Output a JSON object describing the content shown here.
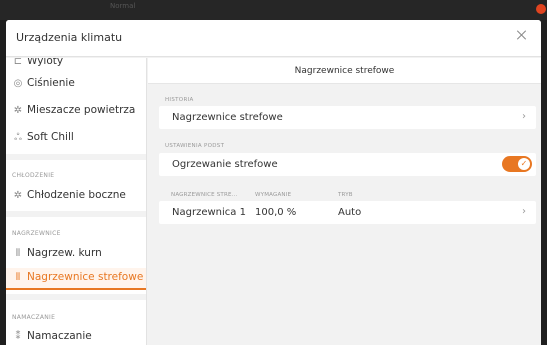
{
  "window": {
    "title": "Urządzenia klimatu",
    "background_label": "Normal"
  },
  "sidebar": {
    "items_top": [
      {
        "label": "Wyloty",
        "icon": "vent-icon"
      },
      {
        "label": "Ciśnienie",
        "icon": "pressure-icon"
      },
      {
        "label": "Mieszacze powietrza",
        "icon": "fan-icon"
      },
      {
        "label": "Soft Chill",
        "icon": "soft-chill-icon"
      }
    ],
    "section_cooling": {
      "title": "CHŁODZENIE",
      "items": [
        {
          "label": "Chłodzenie boczne",
          "icon": "fan-icon"
        }
      ]
    },
    "section_heaters": {
      "title": "NAGRZEWNICE",
      "items": [
        {
          "label": "Nagrzew. kurn",
          "icon": "heater-icon"
        },
        {
          "label": "Nagrzewnice strefowe",
          "icon": "heater-icon",
          "active": true
        }
      ]
    },
    "section_humid": {
      "title": "NAMACZANIE",
      "items": [
        {
          "label": "Namaczanie",
          "icon": "humidify-icon"
        }
      ]
    }
  },
  "main": {
    "title": "Nagrzewnice strefowe",
    "history": {
      "section": "HISTORIA",
      "row_label": "Nagrzewnice strefowe"
    },
    "settings": {
      "section": "USTAWIENIA PODST",
      "row_label": "Ogrzewanie strefowe",
      "toggle_on": true
    },
    "table": {
      "headers": [
        "NAGRZEWNICE STRE...",
        "WYMAGANIE",
        "TRYB"
      ],
      "rows": [
        {
          "name": "Nagrzewnica 1",
          "demand": "100,0 %",
          "mode": "Auto"
        }
      ]
    }
  },
  "colors": {
    "accent": "#e87722",
    "text": "#333333",
    "muted": "#999999",
    "panel": "#f2f2f2",
    "card": "#ffffff"
  }
}
